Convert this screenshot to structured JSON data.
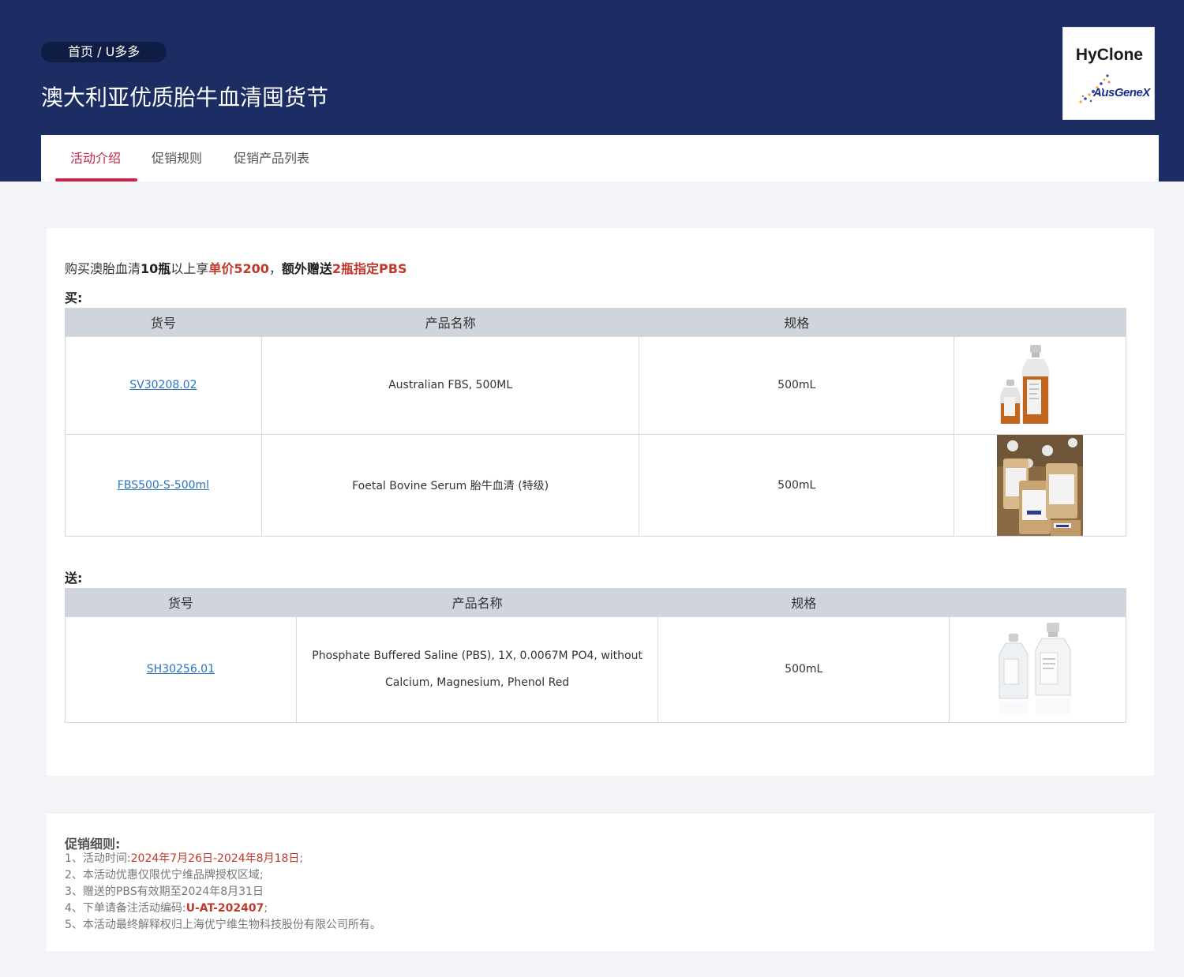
{
  "breadcrumb": "首页 / U多多",
  "page_title": "澳大利亚优质胎牛血清囤货节",
  "logo": {
    "brand": "HyClone",
    "sub": "AusGeneX"
  },
  "tabs": [
    {
      "label": "活动介绍",
      "active": true
    },
    {
      "label": "促销规则",
      "active": false
    },
    {
      "label": "促销产品列表",
      "active": false
    }
  ],
  "promo": {
    "p1": "购买澳胎血清",
    "p2": "10瓶",
    "p3": "以上享",
    "p4": "单价5200",
    "p5": "，",
    "p6": "额外赠送",
    "p7": "2瓶指定PBS"
  },
  "buy": {
    "label": "买:",
    "headers": {
      "sku": "货号",
      "name": "产品名称",
      "spec": "规格"
    },
    "rows": [
      {
        "sku": "SV30208.02",
        "name": "Australian FBS, 500ML",
        "spec": "500mL",
        "image": "amber-serum-bottles"
      },
      {
        "sku": "FBS500-S-500ml",
        "name": "Foetal Bovine Serum 胎牛血清 (特级)",
        "spec": "500mL",
        "image": "ausgenex-serum-bottles"
      }
    ]
  },
  "gift": {
    "label": "送:",
    "headers": {
      "sku": "货号",
      "name": "产品名称",
      "spec": "规格"
    },
    "rows": [
      {
        "sku": "SH30256.01",
        "name_line1": "Phosphate Buffered Saline (PBS), 1X, 0.0067M PO4, without",
        "name_line2": "Calcium, Magnesium, Phenol Red",
        "spec": "500mL",
        "image": "clear-pbs-bottles"
      }
    ]
  },
  "rules": {
    "title": "促销细则:",
    "r1_prefix": "1、活动时间:",
    "r1_value": "2024年7月26日-2024年8月18日",
    "r1_suffix": ";",
    "r2": "2、本活动优惠仅限优宁维品牌授权区域;",
    "r3": "3、赠送的PBS有效期至2024年8月31日",
    "r4_prefix": "4、下单请备注活动编码:",
    "r4_value": "U-AT-202407",
    "r4_suffix": ";",
    "r5": "5、本活动最终解释权归上海优宁维生物科技股份有限公司所有。"
  },
  "colors": {
    "header_bg": "#1b2d63",
    "accent": "#c52645",
    "link": "#2b73c4",
    "promo_red": "#c0392b"
  }
}
